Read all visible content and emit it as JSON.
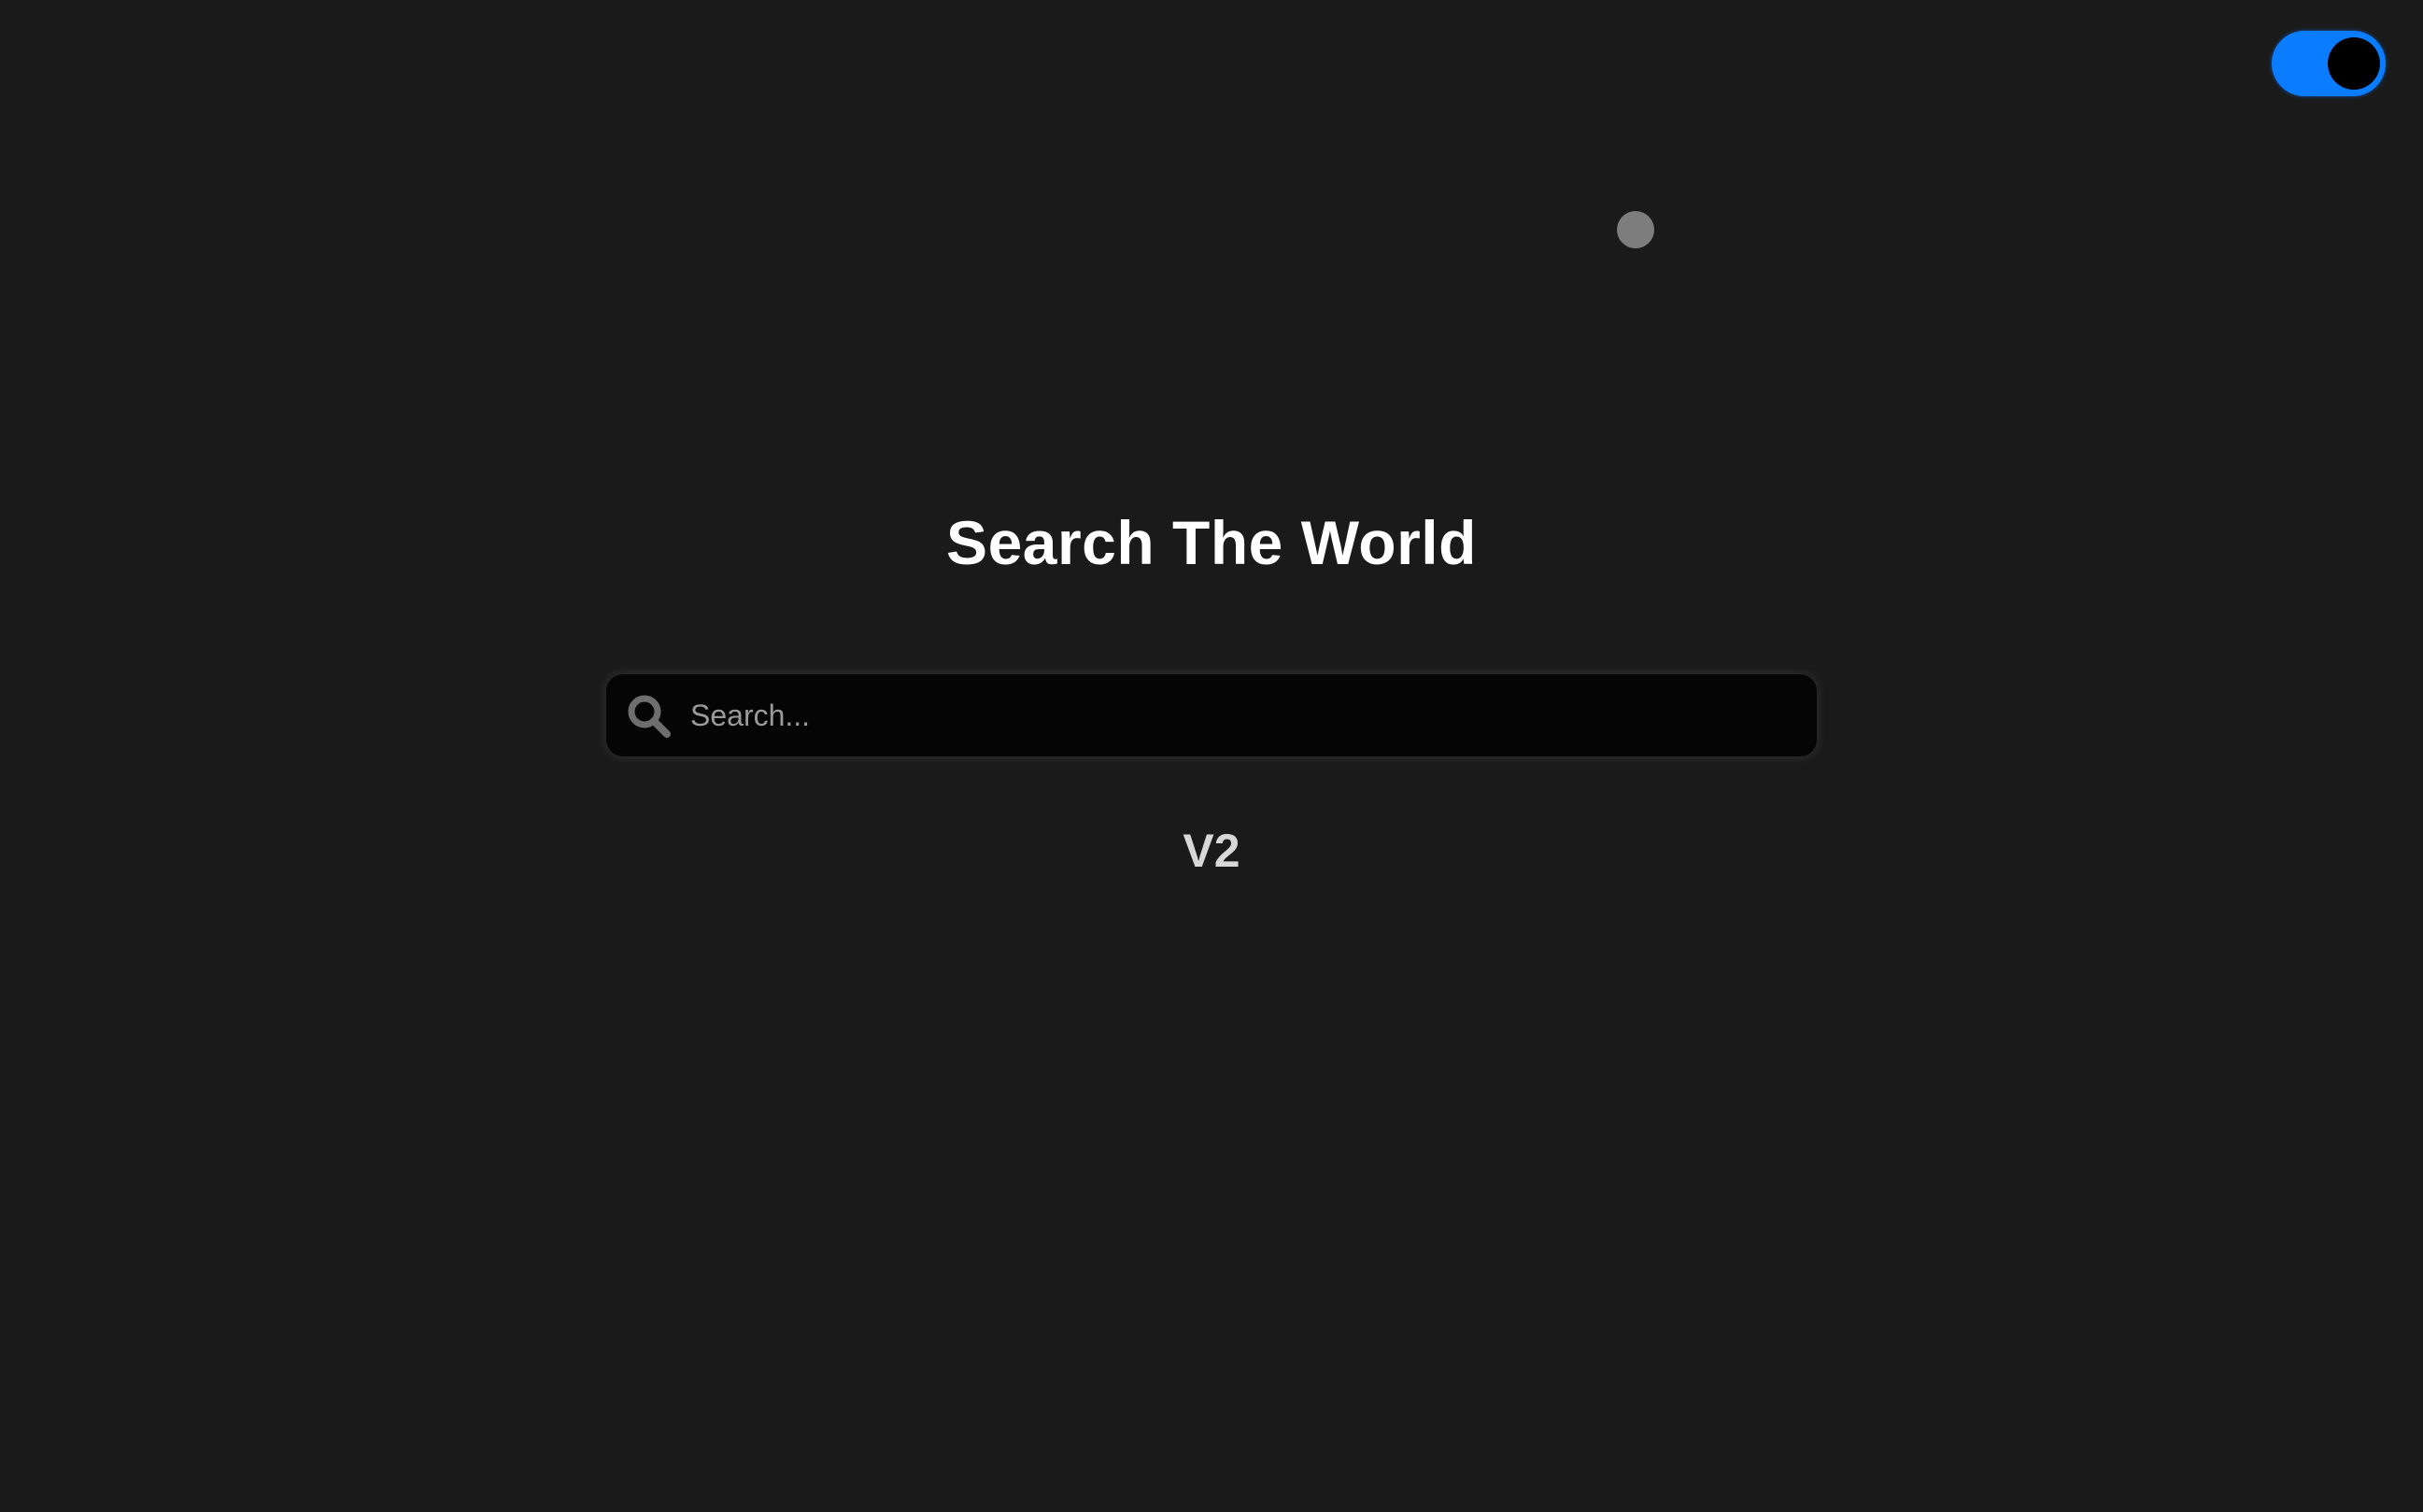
{
  "header": {
    "theme_toggle": {
      "state": "on",
      "accent_color": "#0a7cff"
    }
  },
  "main": {
    "title": "Search The World",
    "search": {
      "placeholder": "Search...",
      "value": "",
      "icon": "search-icon"
    },
    "version_label": "V2"
  },
  "colors": {
    "background": "#1a1a1a",
    "search_background": "#050505",
    "toggle": "#0a7cff"
  }
}
